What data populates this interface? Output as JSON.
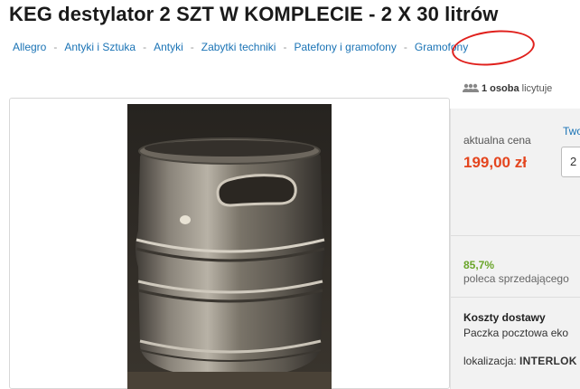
{
  "page": {
    "title": "KEG destylator 2 SZT W KOMPLECIE - 2 X 30 litrów"
  },
  "breadcrumb": [
    "Allegro",
    "Antyki i Sztuka",
    "Antyki",
    "Zabytki techniki",
    "Patefony i gramofony",
    "Gramofony"
  ],
  "bidders": {
    "count": "1 osoba",
    "suffix": "licytuje",
    "icon": "people-icon"
  },
  "gallery": {
    "photo_subject": "keg-photo"
  },
  "offer": {
    "price_label": "aktualna cena",
    "price": "199,00 zł",
    "bid_label": "Twoja",
    "bid_value": "2",
    "seller_rating": "85,7%",
    "seller_rating_text": "poleca sprzedającego",
    "shipping_title": "Koszty dostawy",
    "shipping_value": "Paczka pocztowa eko",
    "location_label": "lokalizacja:",
    "location_value": "INTERLOK"
  },
  "colors": {
    "link": "#1a73b5",
    "price": "#e4451e",
    "rating": "#6aa52a",
    "annotation": "#e0201c"
  }
}
